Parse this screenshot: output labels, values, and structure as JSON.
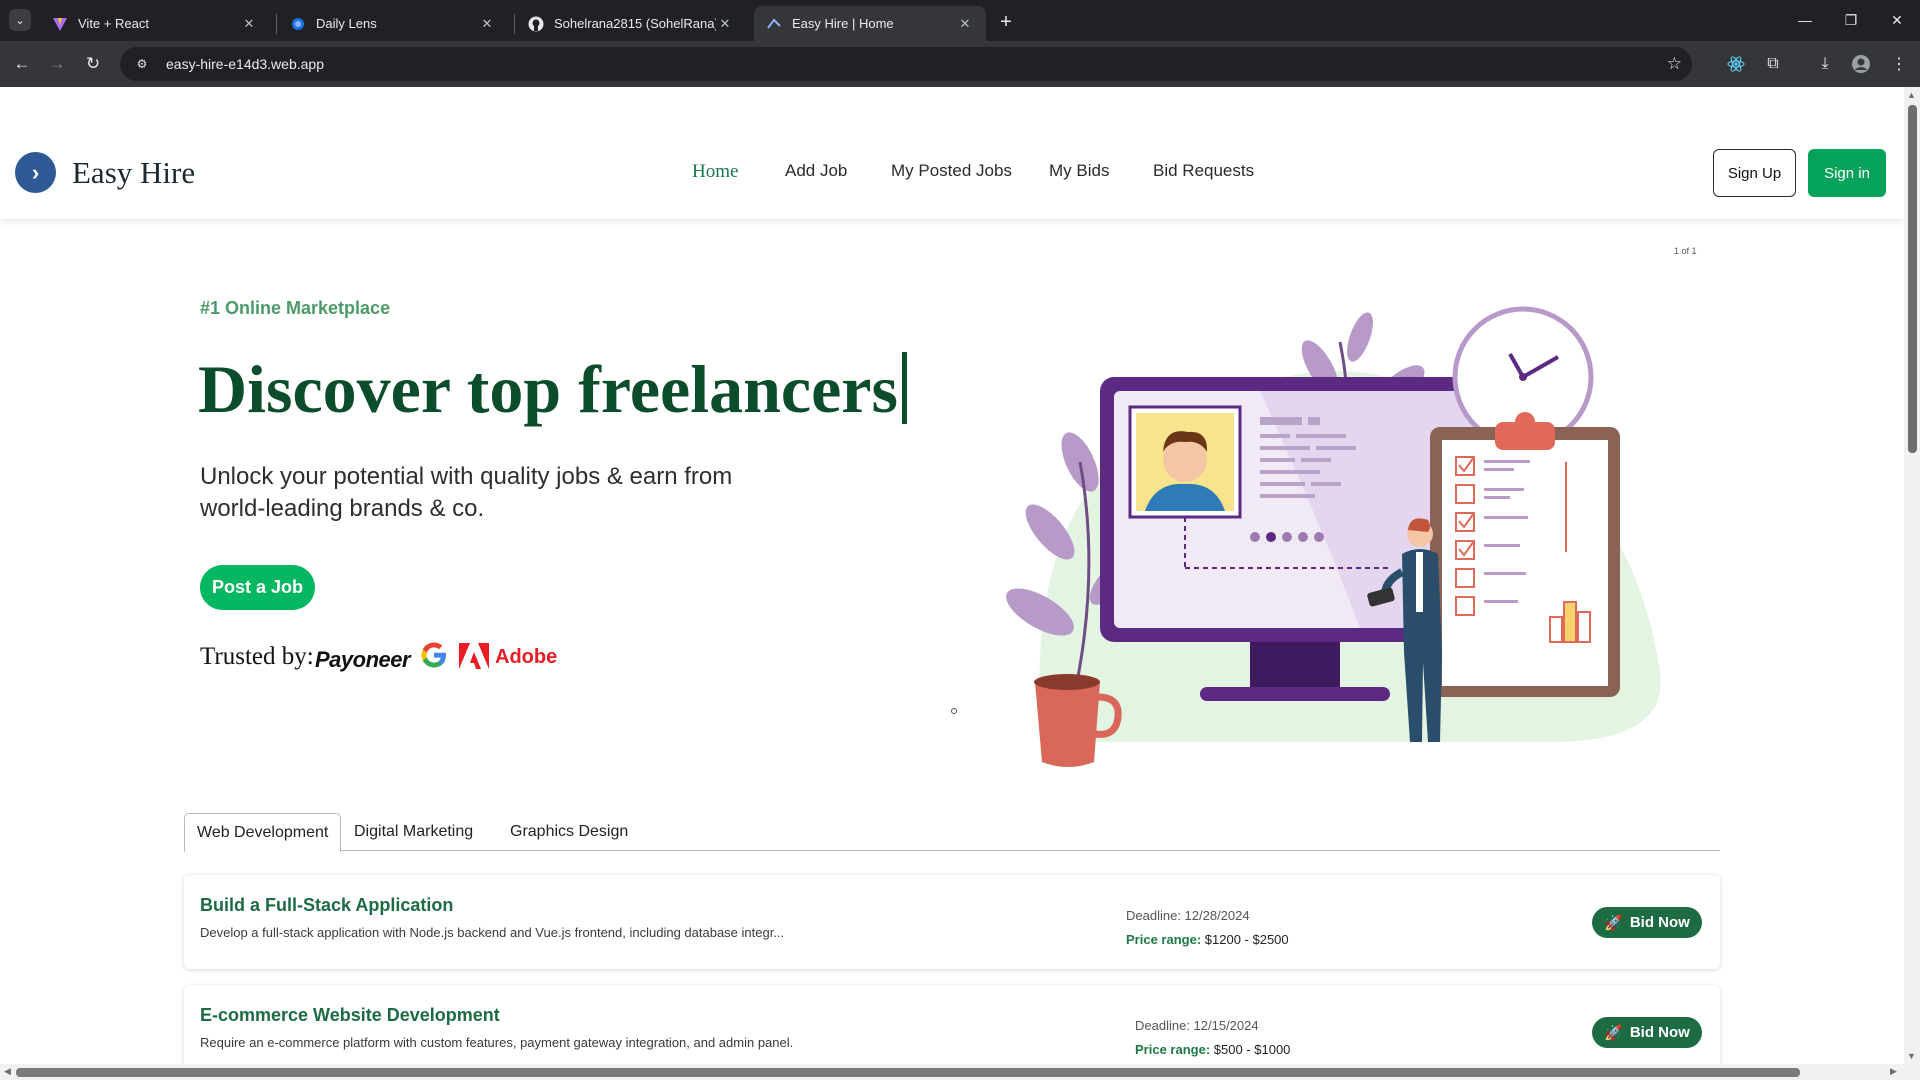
{
  "browser": {
    "tabs": [
      {
        "title": "Vite + React",
        "favicon": "vite-icon"
      },
      {
        "title": "Daily Lens",
        "favicon": "globe-icon"
      },
      {
        "title": "Sohelrana2815 (SohelRana)",
        "favicon": "github-icon"
      },
      {
        "title": "Easy Hire | Home",
        "favicon": "site-icon",
        "active": true
      }
    ],
    "url": "easy-hire-e14d3.web.app"
  },
  "site": {
    "brand": "Easy Hire",
    "nav": [
      "Home",
      "Add Job",
      "My Posted Jobs",
      "My Bids",
      "Bid Requests"
    ],
    "active_nav": "Home",
    "signup_label": "Sign Up",
    "signin_label": "Sign in"
  },
  "hero": {
    "slide_counter": "1 of 1",
    "eyebrow": "#1 Online Marketplace",
    "title": "Discover top freelancers",
    "subtitle": "Unlock your potential with quality jobs & earn from world-leading brands & co.",
    "cta_label": "Post a Job",
    "trusted_label": "Trusted by:",
    "brands": [
      "Payoneer",
      "Google",
      "Adobe"
    ]
  },
  "categories": {
    "tabs": [
      "Web Development",
      "Digital Marketing",
      "Graphics Design"
    ],
    "active": "Web Development"
  },
  "jobs": [
    {
      "title": "Build a Full-Stack Application",
      "description": "Develop a full-stack application with Node.js backend and Vue.js frontend, including database integr...",
      "deadline": "Deadline: 12/28/2024",
      "price_label": "Price range:",
      "price_value": "$1200 - $2500",
      "bid_label": "Bid Now"
    },
    {
      "title": "E-commerce Website Development",
      "description": "Require an e-commerce platform with custom features, payment gateway integration, and admin panel.",
      "deadline": "Deadline: 12/15/2024",
      "price_label": "Price range:",
      "price_value": "$500 - $1000",
      "bid_label": "Bid Now"
    }
  ],
  "colors": {
    "brand_green": "#04a25b",
    "title_green": "#0b4d2a",
    "logo_blue": "#2d5a94"
  }
}
